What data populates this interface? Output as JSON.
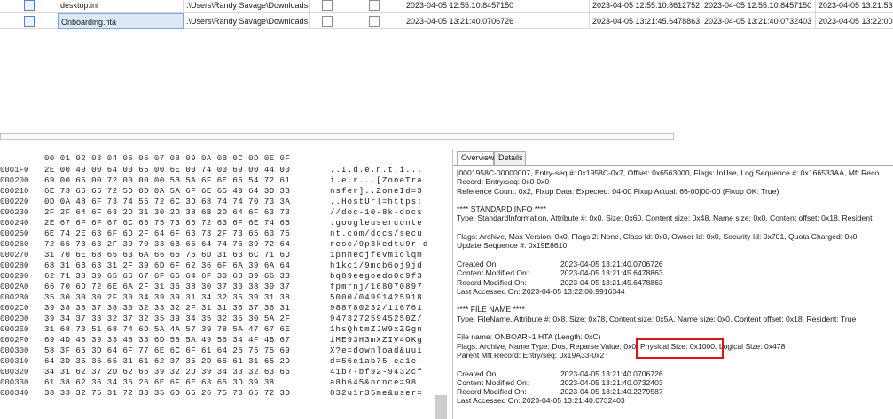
{
  "grid": {
    "rows": [
      {
        "name": "desktop.ini",
        "path": ".\\Users\\Randy Savage\\Downloads",
        "created": "2023-04-05 12:55:10.8457150",
        "modified": "2023-04-05 12:55:10.8612752",
        "record_modified": "2023-04-05 12:55:10.8457150",
        "accessed": "2023-04-05 13:21:53"
      },
      {
        "name": "Onboarding.hta",
        "path": ".\\Users\\Randy Savage\\Downloads",
        "created": "2023-04-05 13:21:40.0706726",
        "modified": "2023-04-05 13:21:45.6478863",
        "record_modified": "2023-04-05 13:21:40.0732403",
        "accessed": "2023-04-05 13:22:00"
      }
    ]
  },
  "hex": {
    "header": "00 01 02 03 04 05 06 07 08 09 0A 0B 0C 0D 0E 0F",
    "lines": [
      {
        "off": "0001F0",
        "bytes": "2E 00 49 00 64 00 65 00 6E 00 74 00 69 00 44 00",
        "ascii": "..I.d.e.n.t.i..."
      },
      {
        "off": "000200",
        "bytes": "69 00 65 00 72 00 00 00 5B 5A 6F 6E 65 54 72 61",
        "ascii": "i.e.r...[ZoneTra"
      },
      {
        "off": "000210",
        "bytes": "6E 73 66 65 72 5D 0D 0A 5A 6F 6E 65 49 64 3D 33",
        "ascii": "nsfer]..ZoneId=3"
      },
      {
        "off": "000220",
        "bytes": "0D 0A 48 6F 73 74 55 72 6C 3D 68 74 74 70 73 3A",
        "ascii": "..HostUrl=https:"
      },
      {
        "off": "000230",
        "bytes": "2F 2F 64 6F 63 2D 31 30 2D 38 6B 2D 64 6F 63 73",
        "ascii": "//doc-10-8k-docs"
      },
      {
        "off": "000240",
        "bytes": "2E 67 6F 6F 67 6C 65 75 73 65 72 63 6F 6E 74 65",
        "ascii": ".googleuserconte"
      },
      {
        "off": "000250",
        "bytes": "6E 74 2E 63 6F 6D 2F 64 6F 63 73 2F 73 65 63 75",
        "ascii": "nt.com/docs/secu"
      },
      {
        "off": "000260",
        "bytes": "72 65 73 63 2F 39 70 33 6B 65 64 74 75 39 72 64",
        "ascii": "resc/9p3kedtu9r d"
      },
      {
        "off": "000270",
        "bytes": "31 70 6E 68 65 63 6A 66 65 76 6D 31 63 6C 71 6D",
        "ascii": "1pnhecjfevm1clqm"
      },
      {
        "off": "000280",
        "bytes": "68 31 6B 63 31 2F 39 6D 6F 62 36 6F 6A 39 6A 64",
        "ascii": "h1kc1/9mob6oj9jd"
      },
      {
        "off": "000290",
        "bytes": "62 71 38 39 65 65 67 6F 65 64 6F 30 63 39 66 33",
        "ascii": "bq89eegoedo0c9f3"
      },
      {
        "off": "0002A0",
        "bytes": "66 70 6D 72 6E 6A 2F 31 36 38 30 37 30 38 39 37",
        "ascii": "fpmrnj/168070897"
      },
      {
        "off": "0002B0",
        "bytes": "35 30 30 30 2F 30 34 39 39 31 34 32 35 39 31 38",
        "ascii": "5000/04991425918"
      },
      {
        "off": "0002C0",
        "bytes": "39 38 38 37 38 30 32 33 32 2F 31 31 36 37 36 31",
        "ascii": "988780232/116761"
      },
      {
        "off": "0002D0",
        "bytes": "39 34 37 33 32 37 32 35 39 34 35 32 35 30 5A 2F",
        "ascii": "94732725945250Z/"
      },
      {
        "off": "0002E0",
        "bytes": "31 68 73 51 68 74 6D 5A 4A 57 39 78 5A 47 67 6E",
        "ascii": "1hsQhtmZJW9xZGgn"
      },
      {
        "off": "0002F0",
        "bytes": "69 4D 45 39 33 48 33 6D 58 5A 49 56 34 4F 4B 67",
        "ascii": "iME93H3mXZIV4OKg"
      },
      {
        "off": "000300",
        "bytes": "58 3F 65 3D 64 6F 77 6E 6C 6F 61 64 26 75 75 69",
        "ascii": "X?e=download&uui"
      },
      {
        "off": "000310",
        "bytes": "64 3D 35 36 65 31 61 62 37 35 2D 65 61 31 65 2D",
        "ascii": "d=56e1ab75-ea1e-"
      },
      {
        "off": "000320",
        "bytes": "34 31 62 37 2D 62 66 39 32 2D 39 34 33 32 63 66",
        "ascii": "41b7-bf92-9432cf"
      },
      {
        "off": "000330",
        "bytes": "61 38 62 36 34 35 26 6E 6F 6E 63 65 3D 39 38",
        "ascii": "a8b645&nonce=98"
      },
      {
        "off": "000340",
        "bytes": "38 33 32 75 31 72 33 35 6D 65 26 75 73 65 72 3D",
        "ascii": "832u1r35me&user="
      }
    ]
  },
  "details": {
    "tabs": [
      "Overview",
      "Details"
    ],
    "lines": [
      "[0001958C-00000007, Entry-seq #: 0x1958C-0x7, Offset: 0x6563000, Flags: InUse, Log Sequence #: 0x166533AA, Mft Reco",
      "Record: Entry/seq: 0x0-0x0",
      "Reference Count: 0x2, Fixup Data: Expected: 04-00 Fixup Actual: 66-00|00-00 (Fixup OK: True)",
      "",
      "**** STANDARD INFO ****",
      "Type: StandardInformation, Attribute #: 0x0, Size: 0x60, Content size: 0x48, Name size: 0x0, Content offset: 0x18, Resident",
      "",
      "Flags: Archive, Max Version: 0x0, Flags 2: None, Class Id: 0x0, Owner Id: 0x0, Security Id: 0x701, Quota Charged: 0x0",
      "Update Sequence #: 0x19E8610",
      "",
      "KV:Created On:|2023-04-05 13:21:40.0706726",
      "KV:Content Modified On:|2023-04-05 13:21:45.6478863",
      "KV:Record Modified On:|2023-04-05 13:21:45.6478863",
      "Last Accessed On:   2023-04-05 13:22:00.9916344",
      "",
      "**** FILE NAME ****",
      "Type: FileName, Attribute #: 0x8, Size: 0x78, Content size: 0x5A, Name size: 0x0, Content offset: 0x18, Resident: True",
      "",
      "File name: ONBOAR~1.HTA (Length: 0xC)",
      "Flags: Archive, Name Type: Dos, Reparse Value: 0x0, Physical Size: 0x1000, Logical Size: 0x478",
      "Parent Mft Record: Entry/seq: 0x19A33-0x2",
      "",
      "KV:Created On:|2023-04-05 13:21:40.0706726",
      "KV:Content Modified On:|2023-04-05 13:21:40.0732403",
      "KV:Record Modified On:|2023-04-05 13:21:40.2279587",
      "Last Accessed On:   2023-04-05 13:21:40.0732403"
    ]
  },
  "highlight_color": "#e0121d"
}
